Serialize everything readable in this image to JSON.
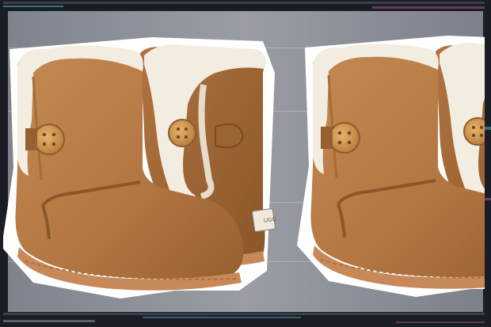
{
  "image": {
    "subject": "pair-of-chestnut-sheepskin-button-boots-collage",
    "brand_label": "UGG",
    "colors": {
      "frame_dark": "#1b1d24",
      "backdrop_gray": "#8a8d96",
      "suede": "#b57a45",
      "suede_dark": "#8e5a2e",
      "suede_light": "#c88d55",
      "fleece": "#f3ece0",
      "sole": "#c7895a",
      "button": "#d49a52",
      "cutout_border": "#ffffff",
      "glitch_cyan": "#52c6d6",
      "glitch_magenta": "#c65fa6"
    }
  }
}
